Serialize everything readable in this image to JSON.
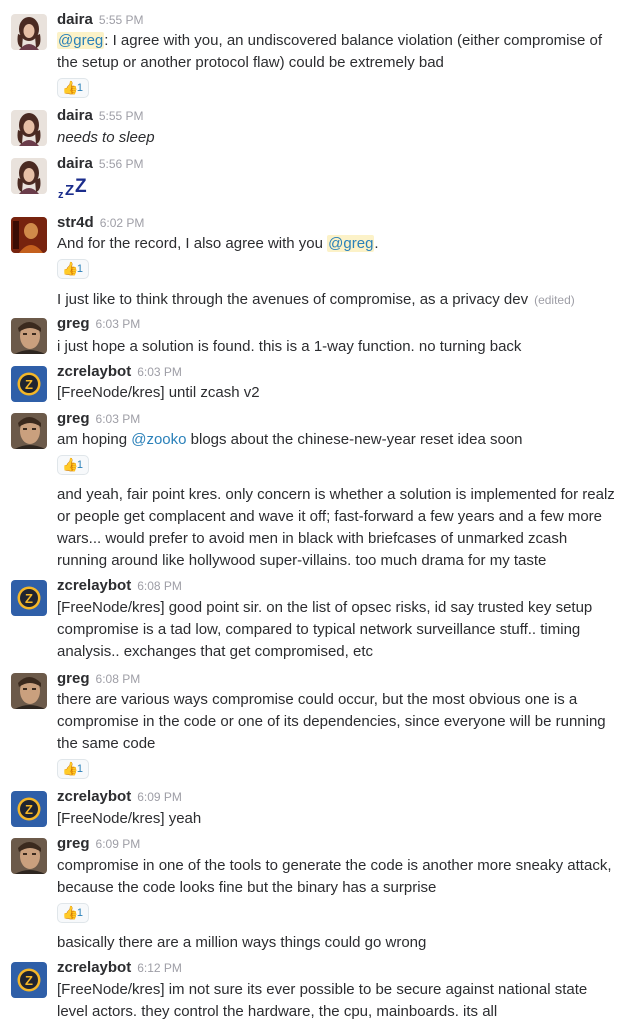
{
  "messages": [
    {
      "author": "daira",
      "time": "5:55 PM"
    },
    {
      "author": "daira",
      "time": "5:55 PM",
      "text": "needs to sleep"
    },
    {
      "author": "daira",
      "time": "5:56 PM",
      "text": "zZZ"
    },
    {
      "author": "str4d",
      "time": "6:02 PM"
    },
    {
      "author": "greg",
      "time": "6:03 PM",
      "text": "i just hope a solution is found. this is a 1-way function. no turning back"
    },
    {
      "author": "zcrelaybot",
      "time": "6:03 PM",
      "text": "[FreeNode/kres] until zcash v2"
    },
    {
      "author": "greg",
      "time": "6:03 PM"
    },
    {
      "author": "zcrelaybot",
      "time": "6:08 PM"
    },
    {
      "author": "greg",
      "time": "6:08 PM"
    },
    {
      "author": "zcrelaybot",
      "time": "6:09 PM",
      "text": "[FreeNode/kres] yeah"
    },
    {
      "author": "greg",
      "time": "6:09 PM"
    },
    {
      "author": "zcrelaybot",
      "time": "6:12 PM"
    }
  ],
  "m1": {
    "mention": "@greg",
    "line1_rest": ": I agree with you, an undiscovered balance violation (either compromise of",
    "line2": "the setup or another protocol flaw) could be extremely bad",
    "reaction_count": "1"
  },
  "m4": {
    "line1_pre": "And for the record, I also agree with you ",
    "mention": "@greg",
    "line1_post": ".",
    "reaction_count": "1",
    "followup": "I just like to think through the avenues of compromise, as a privacy dev",
    "edited": "(edited)"
  },
  "m7": {
    "line1_pre": "am hoping ",
    "mention": "@zooko",
    "line1_post": " blogs about the chinese-new-year reset idea soon",
    "reaction_count": "1",
    "followup": [
      "and yeah, fair point kres. only concern is whether a solution is implemented for realz",
      "or people get complacent and wave it off; fast-forward a few years and a few more",
      "wars... would prefer to avoid men in black with briefcases of unmarked zcash",
      "running around like hollywood super-villains. too much drama for my taste"
    ]
  },
  "m8": {
    "lines": [
      "[FreeNode/kres] good point sir. on the list of opsec risks, id say trusted key setup",
      "compromise is a tad low, compared to typical network surveillance stuff.. timing",
      "analysis.. exchanges that get compromised, etc"
    ]
  },
  "m9": {
    "lines": [
      "there are various ways compromise could occur, but the most obvious one is a",
      "compromise in the code or one of its dependencies, since everyone will be running",
      "the same code"
    ],
    "reaction_count": "1"
  },
  "m11": {
    "lines": [
      "compromise in one of the tools to generate the code is another more sneaky attack,",
      "because the code looks fine but the binary has a surprise"
    ],
    "reaction_count": "1",
    "followup": "basically there are a million ways things could go wrong"
  },
  "m12": {
    "lines": [
      "[FreeNode/kres] im not sure its ever possible to be secure against national state",
      "level actors. they control the hardware, the cpu, mainboards. its all"
    ]
  },
  "reaction_emoji": "👍",
  "colors": {
    "mention_bg": "#fcf2c8",
    "link": "#2a80b9",
    "timestamp": "#9e9ea6",
    "bot_avatar_bg": "#2f5fa8"
  }
}
